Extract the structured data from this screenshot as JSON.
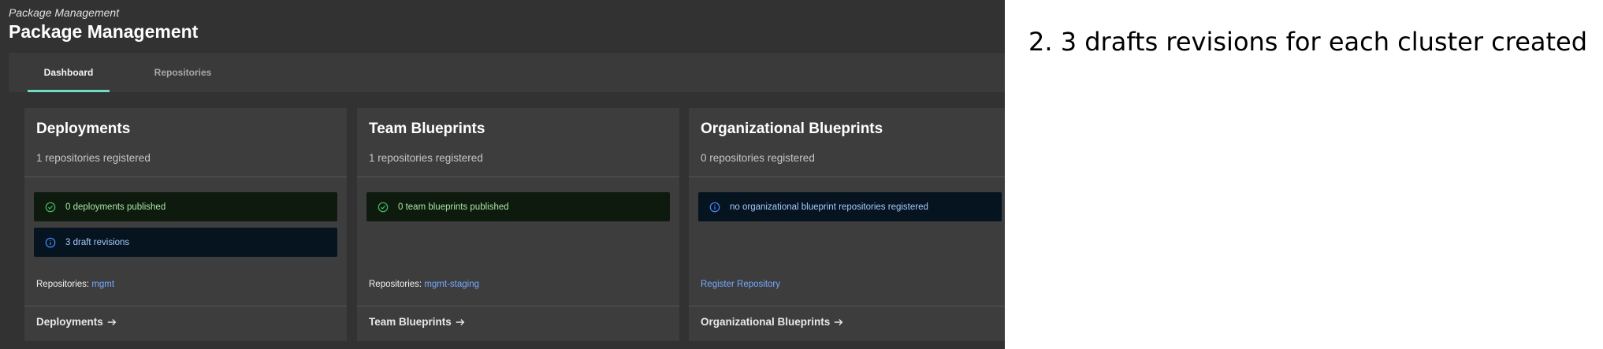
{
  "app": {
    "breadcrumb": "Package Management",
    "title": "Package Management",
    "tabs": [
      {
        "label": "Dashboard",
        "active": true
      },
      {
        "label": "Repositories",
        "active": false
      }
    ]
  },
  "cards": {
    "deployments": {
      "title": "Deployments",
      "subtitle": "1 repositories registered",
      "notifications": [
        {
          "kind": "success",
          "icon": "checkmark-circle-icon",
          "text": "0 deployments published"
        },
        {
          "kind": "info",
          "icon": "info-circle-icon",
          "text": "3 draft revisions"
        }
      ],
      "repos_label": "Repositories:",
      "repos_link": "mgmt",
      "footer_link": "Deployments"
    },
    "team_blueprints": {
      "title": "Team Blueprints",
      "subtitle": "1 repositories registered",
      "notifications": [
        {
          "kind": "success",
          "icon": "checkmark-circle-icon",
          "text": "0 team blueprints published"
        }
      ],
      "repos_label": "Repositories:",
      "repos_link": "mgmt-staging",
      "footer_link": "Team Blueprints"
    },
    "org_blueprints": {
      "title": "Organizational Blueprints",
      "subtitle": "0 repositories registered",
      "notifications": [
        {
          "kind": "info",
          "icon": "info-circle-icon",
          "text": "no organizational blueprint repositories registered"
        }
      ],
      "register_link": "Register Repository",
      "footer_link": "Organizational Blueprints"
    }
  },
  "annotation": "2. 3 drafts revisions for each cluster created",
  "colors": {
    "app_background": "#323232",
    "card_background": "#3d3d3d",
    "tab_indicator": "#6fdcc5",
    "link": "#78a9ff",
    "success_text": "#a7e7a2",
    "info_text": "#a6c8ff"
  }
}
